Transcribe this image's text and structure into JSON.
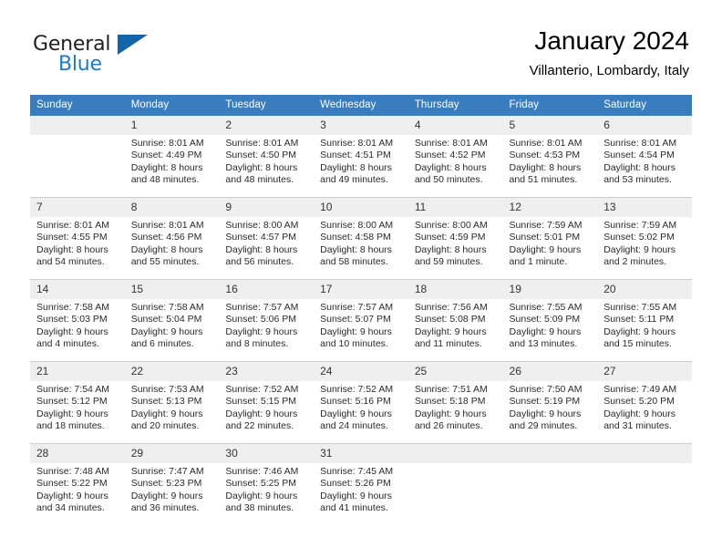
{
  "brand": {
    "word1": "General",
    "word2": "Blue",
    "triangle_color": "#1365a8",
    "blue_text_color": "#1e7bc8"
  },
  "header": {
    "title": "January 2024",
    "subtitle": "Villanterio, Lombardy, Italy"
  },
  "calendar": {
    "header_bg": "#3a7dbf",
    "daynum_bg": "#efefef",
    "weekday_headers": [
      "Sunday",
      "Monday",
      "Tuesday",
      "Wednesday",
      "Thursday",
      "Friday",
      "Saturday"
    ],
    "weeks": [
      [
        {
          "day": "",
          "empty": true
        },
        {
          "day": "1",
          "sunrise": "Sunrise: 8:01 AM",
          "sunset": "Sunset: 4:49 PM",
          "daylight1": "Daylight: 8 hours",
          "daylight2": "and 48 minutes."
        },
        {
          "day": "2",
          "sunrise": "Sunrise: 8:01 AM",
          "sunset": "Sunset: 4:50 PM",
          "daylight1": "Daylight: 8 hours",
          "daylight2": "and 48 minutes."
        },
        {
          "day": "3",
          "sunrise": "Sunrise: 8:01 AM",
          "sunset": "Sunset: 4:51 PM",
          "daylight1": "Daylight: 8 hours",
          "daylight2": "and 49 minutes."
        },
        {
          "day": "4",
          "sunrise": "Sunrise: 8:01 AM",
          "sunset": "Sunset: 4:52 PM",
          "daylight1": "Daylight: 8 hours",
          "daylight2": "and 50 minutes."
        },
        {
          "day": "5",
          "sunrise": "Sunrise: 8:01 AM",
          "sunset": "Sunset: 4:53 PM",
          "daylight1": "Daylight: 8 hours",
          "daylight2": "and 51 minutes."
        },
        {
          "day": "6",
          "sunrise": "Sunrise: 8:01 AM",
          "sunset": "Sunset: 4:54 PM",
          "daylight1": "Daylight: 8 hours",
          "daylight2": "and 53 minutes."
        }
      ],
      [
        {
          "day": "7",
          "sunrise": "Sunrise: 8:01 AM",
          "sunset": "Sunset: 4:55 PM",
          "daylight1": "Daylight: 8 hours",
          "daylight2": "and 54 minutes."
        },
        {
          "day": "8",
          "sunrise": "Sunrise: 8:01 AM",
          "sunset": "Sunset: 4:56 PM",
          "daylight1": "Daylight: 8 hours",
          "daylight2": "and 55 minutes."
        },
        {
          "day": "9",
          "sunrise": "Sunrise: 8:00 AM",
          "sunset": "Sunset: 4:57 PM",
          "daylight1": "Daylight: 8 hours",
          "daylight2": "and 56 minutes."
        },
        {
          "day": "10",
          "sunrise": "Sunrise: 8:00 AM",
          "sunset": "Sunset: 4:58 PM",
          "daylight1": "Daylight: 8 hours",
          "daylight2": "and 58 minutes."
        },
        {
          "day": "11",
          "sunrise": "Sunrise: 8:00 AM",
          "sunset": "Sunset: 4:59 PM",
          "daylight1": "Daylight: 8 hours",
          "daylight2": "and 59 minutes."
        },
        {
          "day": "12",
          "sunrise": "Sunrise: 7:59 AM",
          "sunset": "Sunset: 5:01 PM",
          "daylight1": "Daylight: 9 hours",
          "daylight2": "and 1 minute."
        },
        {
          "day": "13",
          "sunrise": "Sunrise: 7:59 AM",
          "sunset": "Sunset: 5:02 PM",
          "daylight1": "Daylight: 9 hours",
          "daylight2": "and 2 minutes."
        }
      ],
      [
        {
          "day": "14",
          "sunrise": "Sunrise: 7:58 AM",
          "sunset": "Sunset: 5:03 PM",
          "daylight1": "Daylight: 9 hours",
          "daylight2": "and 4 minutes."
        },
        {
          "day": "15",
          "sunrise": "Sunrise: 7:58 AM",
          "sunset": "Sunset: 5:04 PM",
          "daylight1": "Daylight: 9 hours",
          "daylight2": "and 6 minutes."
        },
        {
          "day": "16",
          "sunrise": "Sunrise: 7:57 AM",
          "sunset": "Sunset: 5:06 PM",
          "daylight1": "Daylight: 9 hours",
          "daylight2": "and 8 minutes."
        },
        {
          "day": "17",
          "sunrise": "Sunrise: 7:57 AM",
          "sunset": "Sunset: 5:07 PM",
          "daylight1": "Daylight: 9 hours",
          "daylight2": "and 10 minutes."
        },
        {
          "day": "18",
          "sunrise": "Sunrise: 7:56 AM",
          "sunset": "Sunset: 5:08 PM",
          "daylight1": "Daylight: 9 hours",
          "daylight2": "and 11 minutes."
        },
        {
          "day": "19",
          "sunrise": "Sunrise: 7:55 AM",
          "sunset": "Sunset: 5:09 PM",
          "daylight1": "Daylight: 9 hours",
          "daylight2": "and 13 minutes."
        },
        {
          "day": "20",
          "sunrise": "Sunrise: 7:55 AM",
          "sunset": "Sunset: 5:11 PM",
          "daylight1": "Daylight: 9 hours",
          "daylight2": "and 15 minutes."
        }
      ],
      [
        {
          "day": "21",
          "sunrise": "Sunrise: 7:54 AM",
          "sunset": "Sunset: 5:12 PM",
          "daylight1": "Daylight: 9 hours",
          "daylight2": "and 18 minutes."
        },
        {
          "day": "22",
          "sunrise": "Sunrise: 7:53 AM",
          "sunset": "Sunset: 5:13 PM",
          "daylight1": "Daylight: 9 hours",
          "daylight2": "and 20 minutes."
        },
        {
          "day": "23",
          "sunrise": "Sunrise: 7:52 AM",
          "sunset": "Sunset: 5:15 PM",
          "daylight1": "Daylight: 9 hours",
          "daylight2": "and 22 minutes."
        },
        {
          "day": "24",
          "sunrise": "Sunrise: 7:52 AM",
          "sunset": "Sunset: 5:16 PM",
          "daylight1": "Daylight: 9 hours",
          "daylight2": "and 24 minutes."
        },
        {
          "day": "25",
          "sunrise": "Sunrise: 7:51 AM",
          "sunset": "Sunset: 5:18 PM",
          "daylight1": "Daylight: 9 hours",
          "daylight2": "and 26 minutes."
        },
        {
          "day": "26",
          "sunrise": "Sunrise: 7:50 AM",
          "sunset": "Sunset: 5:19 PM",
          "daylight1": "Daylight: 9 hours",
          "daylight2": "and 29 minutes."
        },
        {
          "day": "27",
          "sunrise": "Sunrise: 7:49 AM",
          "sunset": "Sunset: 5:20 PM",
          "daylight1": "Daylight: 9 hours",
          "daylight2": "and 31 minutes."
        }
      ],
      [
        {
          "day": "28",
          "sunrise": "Sunrise: 7:48 AM",
          "sunset": "Sunset: 5:22 PM",
          "daylight1": "Daylight: 9 hours",
          "daylight2": "and 34 minutes."
        },
        {
          "day": "29",
          "sunrise": "Sunrise: 7:47 AM",
          "sunset": "Sunset: 5:23 PM",
          "daylight1": "Daylight: 9 hours",
          "daylight2": "and 36 minutes."
        },
        {
          "day": "30",
          "sunrise": "Sunrise: 7:46 AM",
          "sunset": "Sunset: 5:25 PM",
          "daylight1": "Daylight: 9 hours",
          "daylight2": "and 38 minutes."
        },
        {
          "day": "31",
          "sunrise": "Sunrise: 7:45 AM",
          "sunset": "Sunset: 5:26 PM",
          "daylight1": "Daylight: 9 hours",
          "daylight2": "and 41 minutes."
        },
        {
          "day": "",
          "empty": true
        },
        {
          "day": "",
          "empty": true
        },
        {
          "day": "",
          "empty": true
        }
      ]
    ]
  }
}
